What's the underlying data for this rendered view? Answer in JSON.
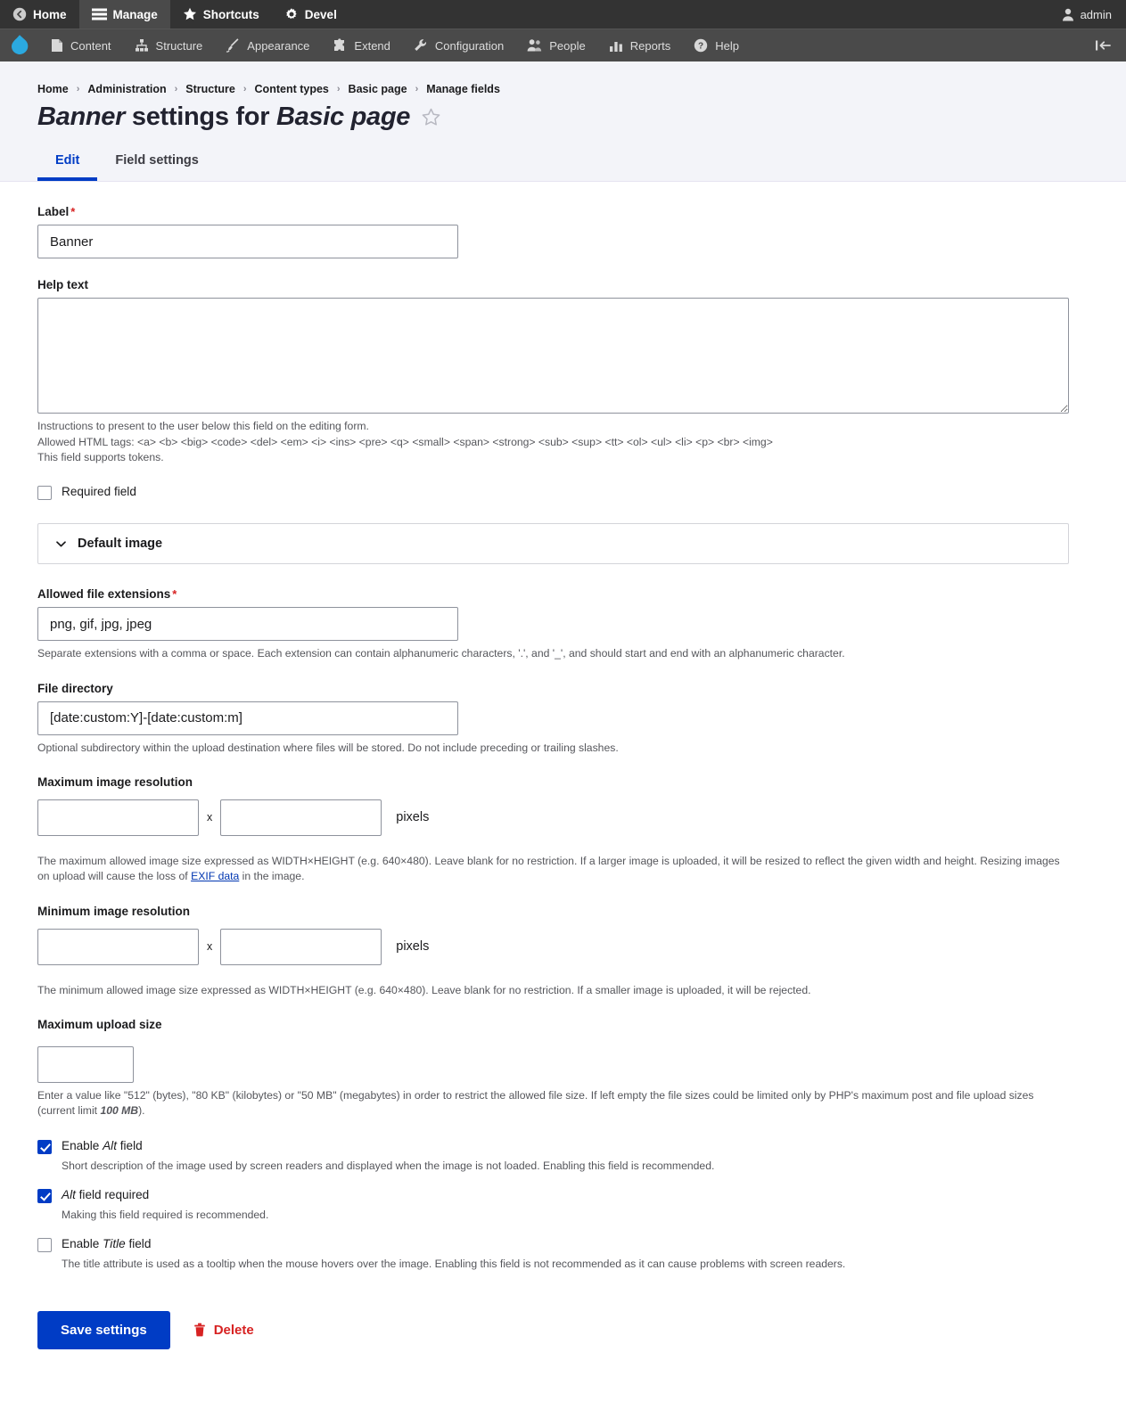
{
  "toolbar": {
    "items": [
      {
        "label": "Home",
        "icon": "home-back-icon",
        "active": false
      },
      {
        "label": "Manage",
        "icon": "hamburger-icon",
        "active": true
      },
      {
        "label": "Shortcuts",
        "icon": "star-icon",
        "active": false
      },
      {
        "label": "Devel",
        "icon": "gear-icon",
        "active": false
      }
    ],
    "user": {
      "label": "admin",
      "icon": "user-icon"
    }
  },
  "tray": {
    "logo": "drupal-logo-icon",
    "items": [
      {
        "label": "Content",
        "icon": "document-icon"
      },
      {
        "label": "Structure",
        "icon": "structure-icon"
      },
      {
        "label": "Appearance",
        "icon": "paintbrush-icon"
      },
      {
        "label": "Extend",
        "icon": "puzzle-icon"
      },
      {
        "label": "Configuration",
        "icon": "wrench-icon"
      },
      {
        "label": "People",
        "icon": "people-icon"
      },
      {
        "label": "Reports",
        "icon": "bar-chart-icon"
      },
      {
        "label": "Help",
        "icon": "question-mark-icon"
      }
    ],
    "collapse": "collapse-toolbar-icon"
  },
  "breadcrumb": [
    "Home",
    "Administration",
    "Structure",
    "Content types",
    "Basic page",
    "Manage fields"
  ],
  "breadcrumb_separator": "›",
  "page": {
    "title_field": "Banner",
    "title_middle": " settings for ",
    "title_bundle": "Basic page",
    "star_icon": "star-outline-icon"
  },
  "tabs": [
    {
      "label": "Edit",
      "active": true
    },
    {
      "label": "Field settings",
      "active": false
    }
  ],
  "form": {
    "label": {
      "label": "Label",
      "required": true,
      "value": "Banner"
    },
    "help_text": {
      "label": "Help text",
      "value": "",
      "desc_line1": "Instructions to present to the user below this field on the editing form.",
      "desc_line2": "Allowed HTML tags: <a> <b> <big> <code> <del> <em> <i> <ins> <pre> <q> <small> <span> <strong> <sub> <sup> <tt> <ol> <ul> <li> <p> <br> <img>",
      "desc_line3": "This field supports tokens."
    },
    "required_field": {
      "label": "Required field",
      "checked": false
    },
    "default_image": {
      "label": "Default image",
      "expanded": false,
      "chevron": "chevron-down-icon"
    },
    "allowed_extensions": {
      "label": "Allowed file extensions",
      "required": true,
      "value": "png, gif, jpg, jpeg",
      "desc": "Separate extensions with a comma or space. Each extension can contain alphanumeric characters, '.', and '_', and should start and end with an alphanumeric character."
    },
    "file_directory": {
      "label": "File directory",
      "value": "[date:custom:Y]-[date:custom:m]",
      "desc": "Optional subdirectory within the upload destination where files will be stored. Do not include preceding or trailing slashes."
    },
    "max_resolution": {
      "label": "Maximum image resolution",
      "width_value": "",
      "height_value": "",
      "separator": "x",
      "unit": "pixels",
      "desc_before_link": "The maximum allowed image size expressed as WIDTH×HEIGHT (e.g. 640×480). Leave blank for no restriction. If a larger image is uploaded, it will be resized to reflect the given width and height. Resizing images on upload will cause the loss of ",
      "desc_link": "EXIF data",
      "desc_after_link": " in the image."
    },
    "min_resolution": {
      "label": "Minimum image resolution",
      "width_value": "",
      "height_value": "",
      "separator": "x",
      "unit": "pixels",
      "desc": "The minimum allowed image size expressed as WIDTH×HEIGHT (e.g. 640×480). Leave blank for no restriction. If a smaller image is uploaded, it will be rejected."
    },
    "max_upload_size": {
      "label": "Maximum upload size",
      "value": "",
      "desc_before_em": "Enter a value like \"512\" (bytes), \"80 KB\" (kilobytes) or \"50 MB\" (megabytes) in order to restrict the allowed file size. If left empty the file sizes could be limited only by PHP's maximum post and file upload sizes (current limit ",
      "desc_em": "100 MB",
      "desc_after_em": ")."
    },
    "enable_alt": {
      "label_before": "Enable ",
      "label_em": "Alt",
      "label_after": " field",
      "checked": true,
      "desc": "Short description of the image used by screen readers and displayed when the image is not loaded. Enabling this field is recommended."
    },
    "alt_required": {
      "label_em": "Alt",
      "label_after": " field required",
      "checked": true,
      "desc": "Making this field required is recommended."
    },
    "enable_title": {
      "label_before": "Enable ",
      "label_em": "Title",
      "label_after": " field",
      "checked": false,
      "desc": "The title attribute is used as a tooltip when the mouse hovers over the image. Enabling this field is not recommended as it can cause problems with screen readers."
    }
  },
  "actions": {
    "save_label": "Save settings",
    "delete_label": "Delete",
    "delete_icon": "trash-icon"
  },
  "colors": {
    "primary": "#003cc5",
    "danger": "#d72222",
    "toolbar_bg": "#333333",
    "tray_bg": "#4a4a4a",
    "header_bg": "#f3f4f9"
  }
}
